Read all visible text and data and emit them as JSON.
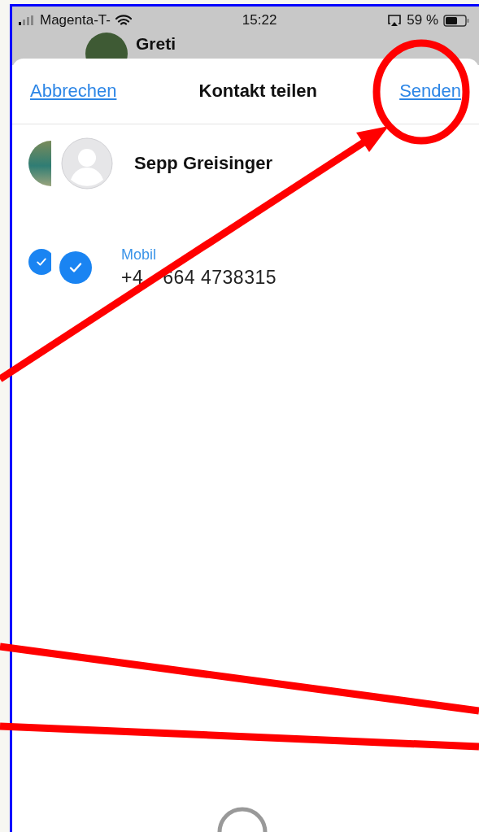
{
  "status_bar": {
    "carrier": "Magenta-T-",
    "time": "15:22",
    "battery": "59 %"
  },
  "chat_header": {
    "name": "Greti"
  },
  "sheet": {
    "cancel": "Abbrechen",
    "title": "Kontakt teilen",
    "send": "Senden"
  },
  "contact": {
    "name": "Sepp Greisinger"
  },
  "phone_entries": [
    {
      "label": "Mobil",
      "number_parts": [
        "+4",
        "664 4738315"
      ],
      "checked": true
    }
  ]
}
